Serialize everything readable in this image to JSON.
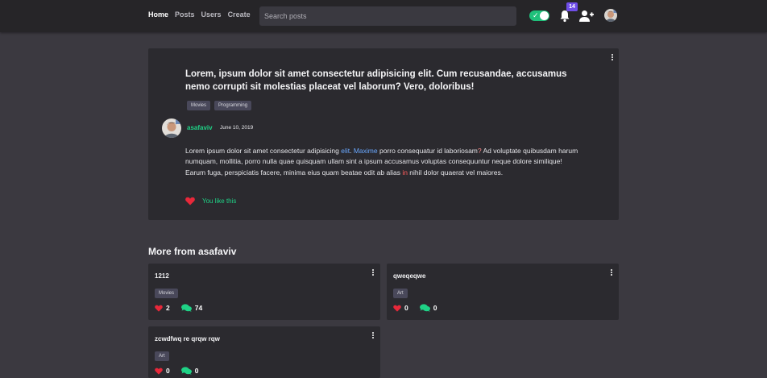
{
  "nav": {
    "items": [
      {
        "label": "Home",
        "active": true
      },
      {
        "label": "Posts",
        "active": false
      },
      {
        "label": "Users",
        "active": false
      },
      {
        "label": "Create",
        "active": false
      }
    ],
    "search_placeholder": "Search posts",
    "notification_count": "14",
    "theme_toggle_on": true
  },
  "post": {
    "title": "Lorem, ipsum dolor sit amet consectetur adipisicing elit. Cum recusandae, accusamus nemo corrupti sit molestias placeat vel laborum? Vero, doloribus!",
    "tags": [
      "Movies",
      "Programming"
    ],
    "author": "asafaviv",
    "date": "June 10, 2019",
    "body": {
      "p1": "Lorem ipsum dolor sit amet consectetur adipisicing ",
      "p2": "elit",
      "p3": ". ",
      "p4": "Maxime",
      "p5": " porro consequatur id laboriosam",
      "p6": "?",
      "p7": " Ad voluptate quibusdam harum numquam, mollitia, porro nulla quae quisquam ullam sint a ipsum accusamus voluptas consequuntur neque dolore similique! Earum fuga, perspiciatis facere, minima eius quam beatae odit ab alias ",
      "p8": "in",
      "p9": " nihil dolor quaerat vel maiores."
    },
    "like_text": "You like this"
  },
  "more": {
    "heading": "More from asafaviv",
    "cards": [
      {
        "title": "1212",
        "tag": "Movies",
        "likes": "2",
        "comments": "74"
      },
      {
        "title": "qweqeqwe",
        "tag": "Art",
        "likes": "0",
        "comments": "0"
      },
      {
        "title": "zcwdfwq re qrqw rqw",
        "tag": "Art",
        "likes": "0",
        "comments": "0"
      }
    ]
  },
  "colors": {
    "accent_green": "#1fd286",
    "heart_red": "#e8283a",
    "badge_purple": "#6f4ee8",
    "card_bg": "#2b2a2f",
    "page_bg": "#3b3940"
  },
  "icons": [
    "bell-icon",
    "add-user-icon",
    "heart-icon",
    "comments-icon",
    "more-vert-icon"
  ]
}
